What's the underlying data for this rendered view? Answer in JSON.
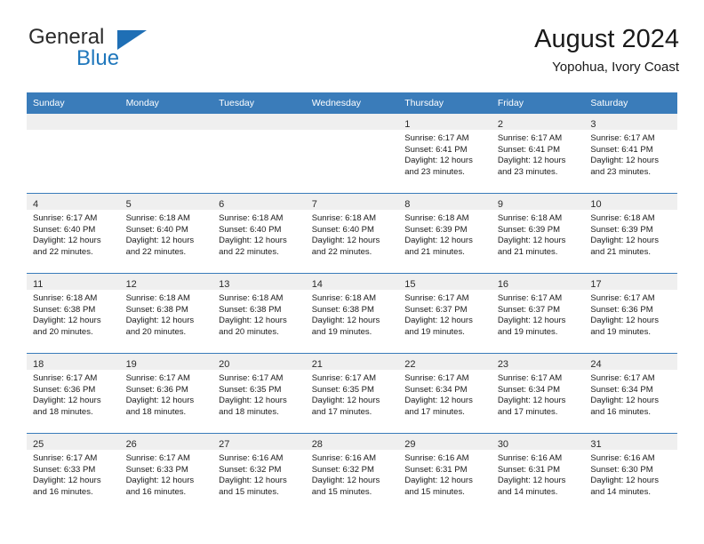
{
  "brand": {
    "name_top": "General",
    "name_bottom": "Blue",
    "flag_icon": "triangle-flag-icon",
    "accent_color": "#1f6fb5"
  },
  "header": {
    "title": "August 2024",
    "subtitle": "Yopohua, Ivory Coast"
  },
  "theme": {
    "header_bg": "#3a7cba",
    "daynum_strip_bg": "#efefef",
    "row_divider": "#3a7cba",
    "text": "#1a1a1a"
  },
  "calendar": {
    "weekday_headers": [
      "Sunday",
      "Monday",
      "Tuesday",
      "Wednesday",
      "Thursday",
      "Friday",
      "Saturday"
    ],
    "weeks": [
      [
        {
          "day": "",
          "empty": true
        },
        {
          "day": "",
          "empty": true
        },
        {
          "day": "",
          "empty": true
        },
        {
          "day": "",
          "empty": true
        },
        {
          "day": "1",
          "sunrise": "Sunrise: 6:17 AM",
          "sunset": "Sunset: 6:41 PM",
          "daylight1": "Daylight: 12 hours",
          "daylight2": "and 23 minutes."
        },
        {
          "day": "2",
          "sunrise": "Sunrise: 6:17 AM",
          "sunset": "Sunset: 6:41 PM",
          "daylight1": "Daylight: 12 hours",
          "daylight2": "and 23 minutes."
        },
        {
          "day": "3",
          "sunrise": "Sunrise: 6:17 AM",
          "sunset": "Sunset: 6:41 PM",
          "daylight1": "Daylight: 12 hours",
          "daylight2": "and 23 minutes."
        }
      ],
      [
        {
          "day": "4",
          "sunrise": "Sunrise: 6:17 AM",
          "sunset": "Sunset: 6:40 PM",
          "daylight1": "Daylight: 12 hours",
          "daylight2": "and 22 minutes."
        },
        {
          "day": "5",
          "sunrise": "Sunrise: 6:18 AM",
          "sunset": "Sunset: 6:40 PM",
          "daylight1": "Daylight: 12 hours",
          "daylight2": "and 22 minutes."
        },
        {
          "day": "6",
          "sunrise": "Sunrise: 6:18 AM",
          "sunset": "Sunset: 6:40 PM",
          "daylight1": "Daylight: 12 hours",
          "daylight2": "and 22 minutes."
        },
        {
          "day": "7",
          "sunrise": "Sunrise: 6:18 AM",
          "sunset": "Sunset: 6:40 PM",
          "daylight1": "Daylight: 12 hours",
          "daylight2": "and 22 minutes."
        },
        {
          "day": "8",
          "sunrise": "Sunrise: 6:18 AM",
          "sunset": "Sunset: 6:39 PM",
          "daylight1": "Daylight: 12 hours",
          "daylight2": "and 21 minutes."
        },
        {
          "day": "9",
          "sunrise": "Sunrise: 6:18 AM",
          "sunset": "Sunset: 6:39 PM",
          "daylight1": "Daylight: 12 hours",
          "daylight2": "and 21 minutes."
        },
        {
          "day": "10",
          "sunrise": "Sunrise: 6:18 AM",
          "sunset": "Sunset: 6:39 PM",
          "daylight1": "Daylight: 12 hours",
          "daylight2": "and 21 minutes."
        }
      ],
      [
        {
          "day": "11",
          "sunrise": "Sunrise: 6:18 AM",
          "sunset": "Sunset: 6:38 PM",
          "daylight1": "Daylight: 12 hours",
          "daylight2": "and 20 minutes."
        },
        {
          "day": "12",
          "sunrise": "Sunrise: 6:18 AM",
          "sunset": "Sunset: 6:38 PM",
          "daylight1": "Daylight: 12 hours",
          "daylight2": "and 20 minutes."
        },
        {
          "day": "13",
          "sunrise": "Sunrise: 6:18 AM",
          "sunset": "Sunset: 6:38 PM",
          "daylight1": "Daylight: 12 hours",
          "daylight2": "and 20 minutes."
        },
        {
          "day": "14",
          "sunrise": "Sunrise: 6:18 AM",
          "sunset": "Sunset: 6:38 PM",
          "daylight1": "Daylight: 12 hours",
          "daylight2": "and 19 minutes."
        },
        {
          "day": "15",
          "sunrise": "Sunrise: 6:17 AM",
          "sunset": "Sunset: 6:37 PM",
          "daylight1": "Daylight: 12 hours",
          "daylight2": "and 19 minutes."
        },
        {
          "day": "16",
          "sunrise": "Sunrise: 6:17 AM",
          "sunset": "Sunset: 6:37 PM",
          "daylight1": "Daylight: 12 hours",
          "daylight2": "and 19 minutes."
        },
        {
          "day": "17",
          "sunrise": "Sunrise: 6:17 AM",
          "sunset": "Sunset: 6:36 PM",
          "daylight1": "Daylight: 12 hours",
          "daylight2": "and 19 minutes."
        }
      ],
      [
        {
          "day": "18",
          "sunrise": "Sunrise: 6:17 AM",
          "sunset": "Sunset: 6:36 PM",
          "daylight1": "Daylight: 12 hours",
          "daylight2": "and 18 minutes."
        },
        {
          "day": "19",
          "sunrise": "Sunrise: 6:17 AM",
          "sunset": "Sunset: 6:36 PM",
          "daylight1": "Daylight: 12 hours",
          "daylight2": "and 18 minutes."
        },
        {
          "day": "20",
          "sunrise": "Sunrise: 6:17 AM",
          "sunset": "Sunset: 6:35 PM",
          "daylight1": "Daylight: 12 hours",
          "daylight2": "and 18 minutes."
        },
        {
          "day": "21",
          "sunrise": "Sunrise: 6:17 AM",
          "sunset": "Sunset: 6:35 PM",
          "daylight1": "Daylight: 12 hours",
          "daylight2": "and 17 minutes."
        },
        {
          "day": "22",
          "sunrise": "Sunrise: 6:17 AM",
          "sunset": "Sunset: 6:34 PM",
          "daylight1": "Daylight: 12 hours",
          "daylight2": "and 17 minutes."
        },
        {
          "day": "23",
          "sunrise": "Sunrise: 6:17 AM",
          "sunset": "Sunset: 6:34 PM",
          "daylight1": "Daylight: 12 hours",
          "daylight2": "and 17 minutes."
        },
        {
          "day": "24",
          "sunrise": "Sunrise: 6:17 AM",
          "sunset": "Sunset: 6:34 PM",
          "daylight1": "Daylight: 12 hours",
          "daylight2": "and 16 minutes."
        }
      ],
      [
        {
          "day": "25",
          "sunrise": "Sunrise: 6:17 AM",
          "sunset": "Sunset: 6:33 PM",
          "daylight1": "Daylight: 12 hours",
          "daylight2": "and 16 minutes."
        },
        {
          "day": "26",
          "sunrise": "Sunrise: 6:17 AM",
          "sunset": "Sunset: 6:33 PM",
          "daylight1": "Daylight: 12 hours",
          "daylight2": "and 16 minutes."
        },
        {
          "day": "27",
          "sunrise": "Sunrise: 6:16 AM",
          "sunset": "Sunset: 6:32 PM",
          "daylight1": "Daylight: 12 hours",
          "daylight2": "and 15 minutes."
        },
        {
          "day": "28",
          "sunrise": "Sunrise: 6:16 AM",
          "sunset": "Sunset: 6:32 PM",
          "daylight1": "Daylight: 12 hours",
          "daylight2": "and 15 minutes."
        },
        {
          "day": "29",
          "sunrise": "Sunrise: 6:16 AM",
          "sunset": "Sunset: 6:31 PM",
          "daylight1": "Daylight: 12 hours",
          "daylight2": "and 15 minutes."
        },
        {
          "day": "30",
          "sunrise": "Sunrise: 6:16 AM",
          "sunset": "Sunset: 6:31 PM",
          "daylight1": "Daylight: 12 hours",
          "daylight2": "and 14 minutes."
        },
        {
          "day": "31",
          "sunrise": "Sunrise: 6:16 AM",
          "sunset": "Sunset: 6:30 PM",
          "daylight1": "Daylight: 12 hours",
          "daylight2": "and 14 minutes."
        }
      ]
    ]
  }
}
